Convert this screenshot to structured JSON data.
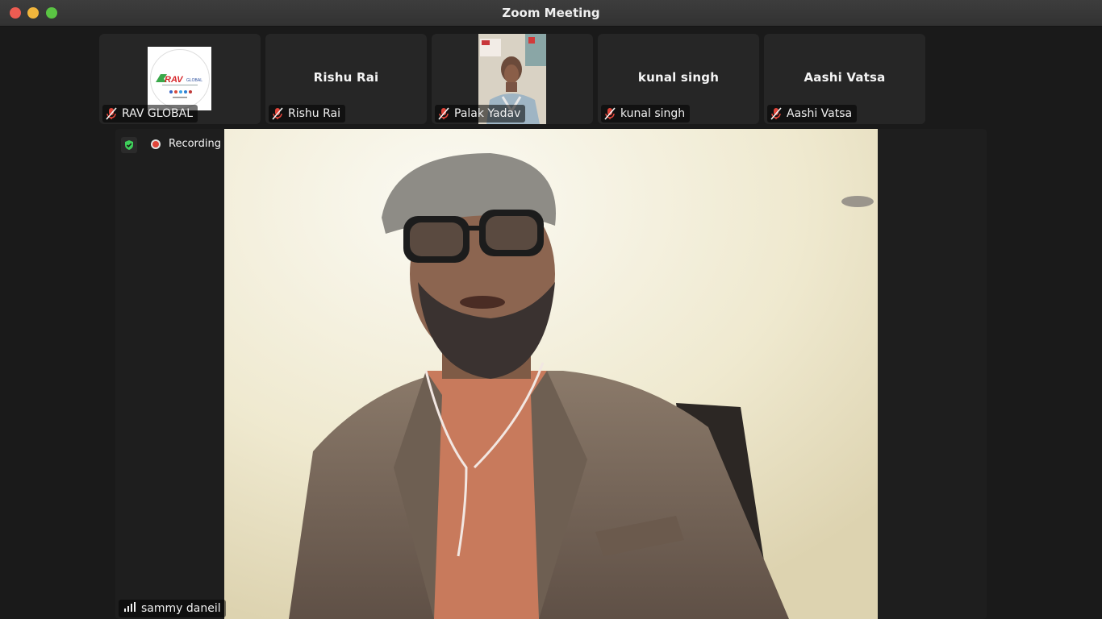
{
  "window": {
    "title": "Zoom Meeting"
  },
  "participants": [
    {
      "name": "RAV GLOBAL",
      "display": "logo",
      "muted": true
    },
    {
      "name": "Rishu Rai",
      "display": "name",
      "muted": true
    },
    {
      "name": "Palak Yadav",
      "display": "video",
      "muted": true
    },
    {
      "name": "kunal singh",
      "display": "name",
      "muted": true
    },
    {
      "name": "Aashi Vatsa",
      "display": "name",
      "muted": true
    }
  ],
  "active_speaker": {
    "name": "sammy daneil"
  },
  "status": {
    "recording_label": "Recording"
  },
  "colors": {
    "close": "#ed5c52",
    "minimize": "#f2b63c",
    "maximize": "#5ac443",
    "muted_icon": "#e0453a",
    "recording_dot": "#e0453a",
    "encryption_shield": "#3ecf5a"
  }
}
